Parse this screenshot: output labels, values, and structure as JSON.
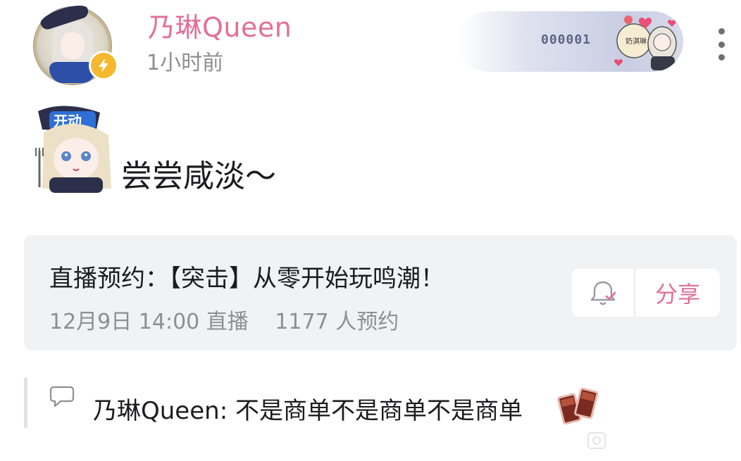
{
  "post": {
    "author": "乃琳Queen",
    "time_ago": "1小时前",
    "fan_badge_number": "000001",
    "content": "尝尝咸淡～"
  },
  "live_reservation": {
    "title": "直播预约：【突击】从零开始玩鸣潮！",
    "schedule": "12月9日 14:00 直播",
    "reservations": "1177 人预约",
    "share_label": "分享"
  },
  "comment": {
    "text": "乃琳Queen: 不是商单不是商单不是商单"
  },
  "icons": {
    "avatar_badge": "lightning-bolt-icon",
    "more": "vertical-ellipsis-icon",
    "bell": "bell-check-icon",
    "comment": "speech-bubble-icon",
    "drink": "cheers-drink-icon"
  },
  "colors": {
    "accent": "#e36f97",
    "secondary_text": "#8e8e94",
    "card_bg": "#f1f2f4",
    "badge_yellow": "#f5b82e"
  }
}
